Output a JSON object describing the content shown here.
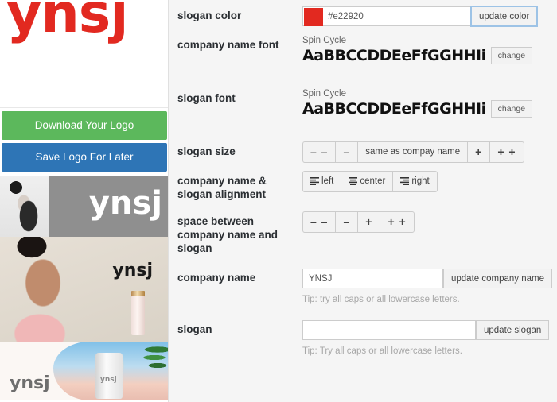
{
  "brand": {
    "logo_text": "ynsj",
    "logo_color": "#e22920"
  },
  "actions": {
    "download": {
      "label": "Download Your Logo",
      "color": "#5cb85c"
    },
    "save": {
      "label": "Save Logo For Later",
      "color": "#2e75b6"
    }
  },
  "previews": [
    {
      "name": "grey-banner-mockup",
      "logo_text": "ynsj"
    },
    {
      "name": "beauty-model-mockup",
      "logo_text": "ynsj"
    },
    {
      "name": "beach-sunscreen-mockup",
      "logo_text": "ynsj",
      "tube_text": "ynsj"
    }
  ],
  "form": {
    "slogan_color": {
      "label": "slogan color",
      "value": "#e22920",
      "swatch_color": "#e22920",
      "button": "update color"
    },
    "company_name_font": {
      "label": "company name font",
      "font_name": "Spin Cycle",
      "sample": "AaBBCCDDEeFfGGHHIi",
      "button": "change"
    },
    "slogan_font": {
      "label": "slogan font",
      "font_name": "Spin Cycle",
      "sample": "AaBBCCDDEeFfGGHHIi",
      "button": "change"
    },
    "slogan_size": {
      "label": "slogan size",
      "buttons": [
        "– –",
        "–",
        "same as compay name",
        "+",
        "+ +"
      ]
    },
    "alignment": {
      "label": "company name & slogan alignment",
      "options": [
        "left",
        "center",
        "right"
      ]
    },
    "spacing": {
      "label": "space between company name and slogan",
      "buttons": [
        "– –",
        "–",
        "+",
        "+ +"
      ]
    },
    "company_name": {
      "label": "company name",
      "value": "YNSJ",
      "button": "update company name",
      "tip": "Tip: try all caps or all lowercase letters."
    },
    "slogan": {
      "label": "slogan",
      "value": "",
      "button": "update slogan",
      "tip": "Tip: Try all caps or all lowercase letters."
    }
  }
}
